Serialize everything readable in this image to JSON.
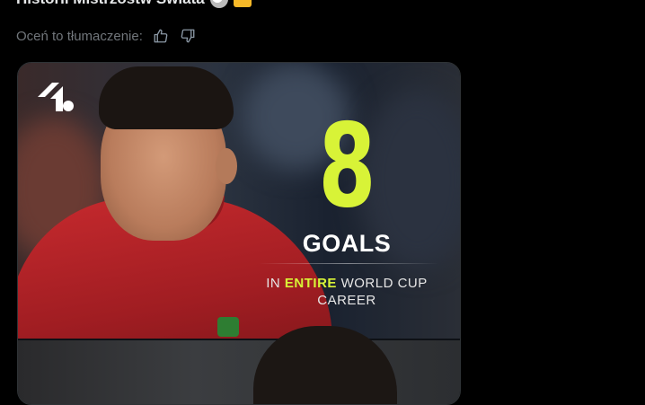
{
  "post": {
    "text_cut": "Historii Mistrzostw Świata",
    "emoji_1": "soccer-ball-emoji",
    "emoji_2": "crown-emoji"
  },
  "rating": {
    "label": "Oceń to tłumaczenie:",
    "thumbs_up_icon": "thumbs-up-icon",
    "thumbs_down_icon": "thumbs-down-icon"
  },
  "media": {
    "brand_logo_icon": "onefootball-logo",
    "stat_number": "8",
    "stat_unit": "GOALS",
    "caption_pre": "IN ",
    "caption_highlight": "ENTIRE",
    "caption_post": " WORLD CUP CAREER",
    "colors": {
      "accent": "#d8f337",
      "shirt": "#c72a2e",
      "background": "#000000"
    }
  }
}
